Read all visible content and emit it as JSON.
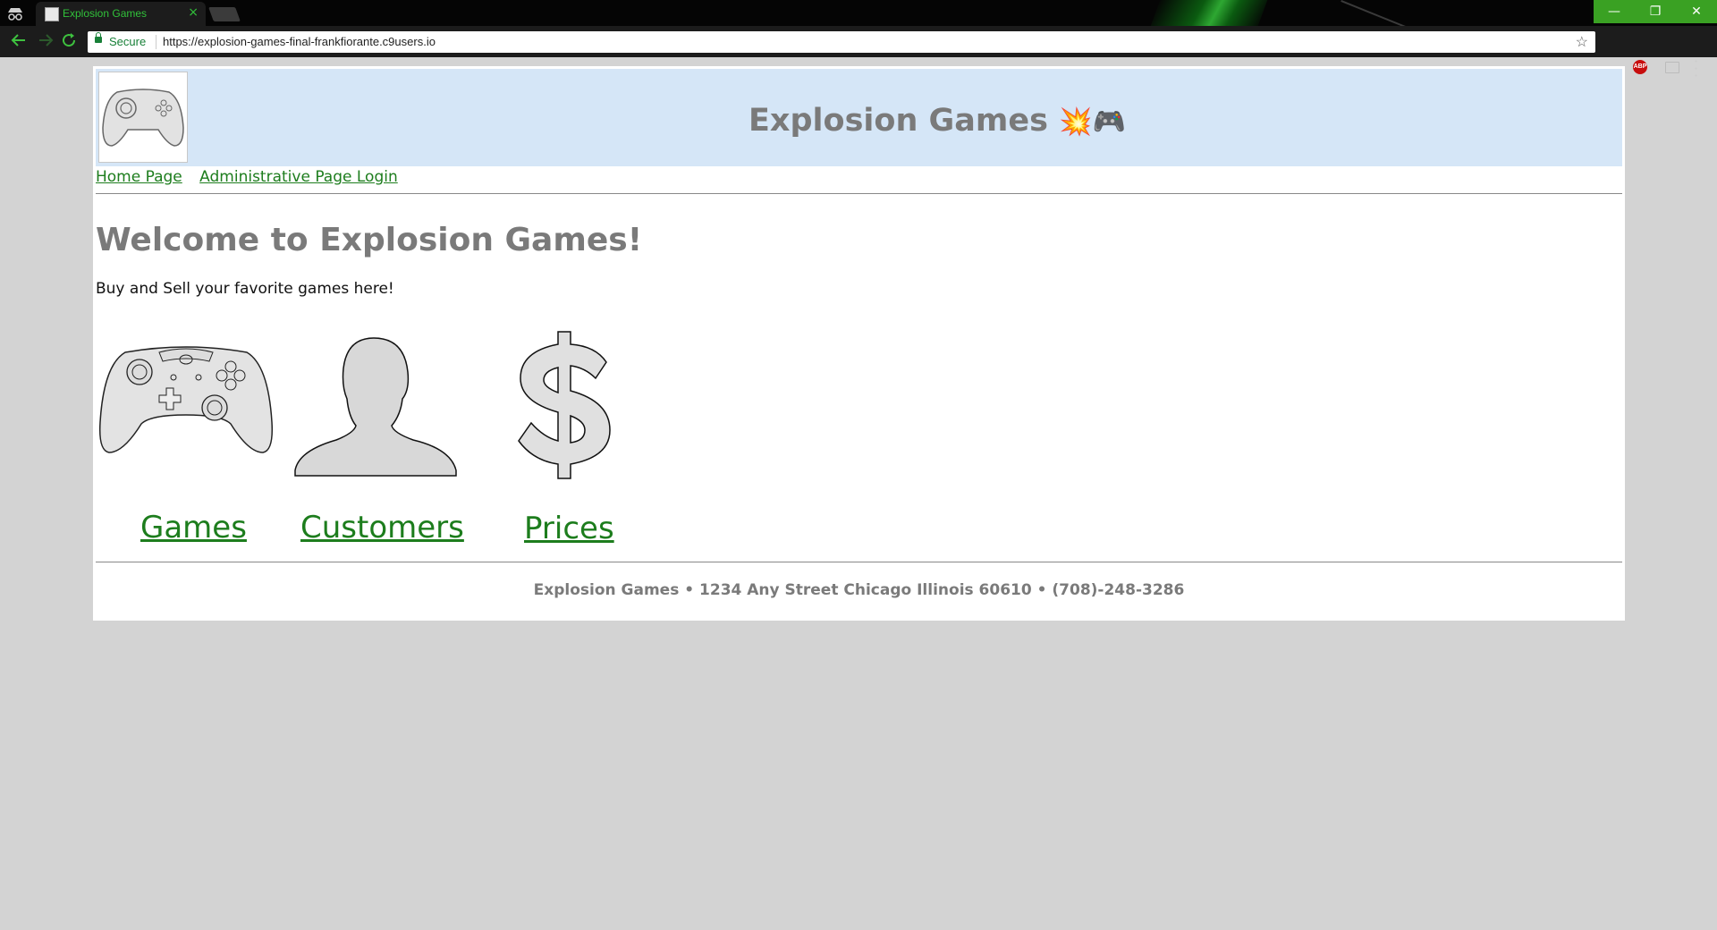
{
  "browser": {
    "tab_title": "Explosion Games",
    "tab_close": "×",
    "secure_label": "Secure",
    "url_scheme": "https://",
    "url_host": "explosion-games-final-frankfiorante.c9users.io",
    "abp_label": "ABP",
    "controls": {
      "minimize": "—",
      "restore": "❐",
      "close": "✕"
    },
    "icons": [
      "incognito-icon",
      "back-icon",
      "forward-icon",
      "reload-icon",
      "lock-icon",
      "star-icon",
      "adblock-icon",
      "cast-icon",
      "menu-icon"
    ]
  },
  "header": {
    "title": "Explosion Games",
    "title_emoji": "💥🎮"
  },
  "nav": {
    "home": "Home Page",
    "admin": "Administrative Page Login"
  },
  "main": {
    "heading": "Welcome to Explosion Games!",
    "tagline": "Buy and Sell your favorite games here!",
    "tiles": [
      {
        "label": "Games",
        "icon": "game-controller-icon"
      },
      {
        "label": "Customers",
        "icon": "person-silhouette-icon"
      },
      {
        "label": "Prices",
        "icon": "dollar-sign-icon"
      }
    ]
  },
  "footer": {
    "text": "Explosion Games • 1234 Any Street Chicago Illinois 60610 • (708)-248-3286"
  },
  "colors": {
    "page_background": "#d3d3d3",
    "header_background": "#d5e6f7",
    "heading_gray": "#7a7a7a",
    "link_green": "#1d7d1d",
    "chrome_accent": "#3aa123"
  }
}
